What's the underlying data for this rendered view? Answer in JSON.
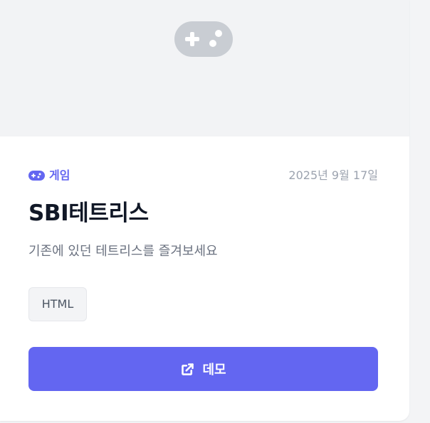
{
  "card": {
    "thumbnail_icon": "gamepad-icon",
    "category": {
      "icon": "gamepad-icon",
      "label": "게임",
      "color": "#6366f1"
    },
    "date": "2025년 9월 17일",
    "title": "SBI테트리스",
    "description": "기존에 있던 테트리스를 즐겨보세요",
    "tags": [
      "HTML"
    ],
    "demo_button": {
      "icon": "external-link-icon",
      "label": "데모"
    }
  },
  "colors": {
    "accent": "#6366f1",
    "thumbnail_background": "#f2f3f5",
    "page_background": "#f3f4f6"
  }
}
